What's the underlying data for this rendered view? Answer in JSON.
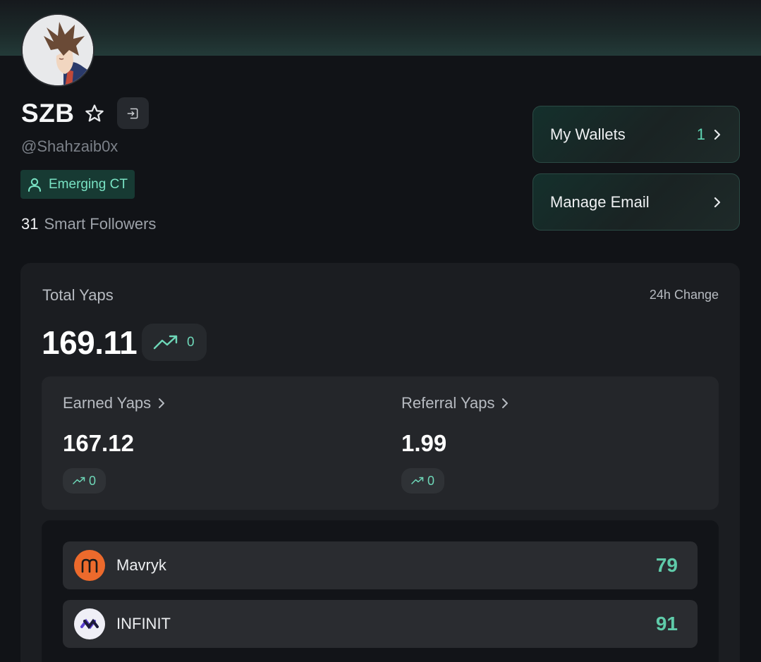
{
  "profile": {
    "name": "SZB",
    "handle": "@Shahzaib0x",
    "badge": "Emerging CT",
    "smart_followers_count": "31",
    "smart_followers_label": "Smart Followers"
  },
  "side_actions": {
    "wallets_label": "My Wallets",
    "wallets_count": "1",
    "email_label": "Manage Email"
  },
  "stats": {
    "total_label": "Total Yaps",
    "change_label": "24h Change",
    "total_value": "169.11",
    "total_change": "0",
    "earned_label": "Earned Yaps",
    "earned_value": "167.12",
    "earned_change": "0",
    "referral_label": "Referral Yaps",
    "referral_value": "1.99",
    "referral_change": "0"
  },
  "projects": [
    {
      "name": "Mavryk",
      "score": "79"
    },
    {
      "name": "INFINIT",
      "score": "91"
    }
  ],
  "colors": {
    "accent": "#5fd6b4",
    "background": "#111317",
    "panel": "#1b1d21",
    "mavryk": "#ec6a2c"
  },
  "icons": [
    "star-icon",
    "logout-icon",
    "user-icon",
    "chevron-right-icon",
    "trending-up-icon"
  ]
}
